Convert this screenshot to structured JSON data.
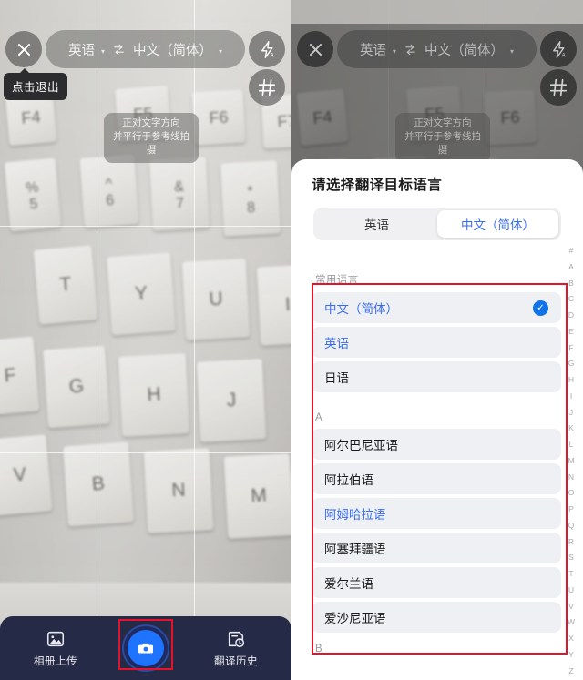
{
  "camera": {
    "close_icon": "close-icon",
    "flash_icon": "flash-auto-icon",
    "grid_icon": "grid-icon",
    "source_language": "英语",
    "swap_icon": "swap-languages-icon",
    "target_language": "中文（简体）",
    "caret": "▾",
    "exit_tooltip": "点击退出",
    "hint_line1": "正对文字方向",
    "hint_line2": "并平行于参考线拍摄",
    "keycaps": [
      "F4",
      "F5",
      "F6",
      "F7",
      "%",
      "5",
      "^",
      "6",
      "&",
      "7",
      "*",
      "8",
      "T",
      "Y",
      "U",
      "I",
      "F",
      "G",
      "H",
      "J",
      "V",
      "B",
      "N",
      "M"
    ]
  },
  "bottom_bar": {
    "album_label": "相册上传",
    "album_icon": "photo-icon",
    "shutter_icon": "camera-icon",
    "history_label": "翻译历史",
    "history_icon": "history-icon"
  },
  "sheet": {
    "title": "请选择翻译目标语言",
    "segments": [
      {
        "label": "英语",
        "active": false
      },
      {
        "label": "中文（简体）",
        "active": true
      }
    ],
    "common_section_label": "常用语言",
    "common_languages": [
      {
        "label": "中文（简体）",
        "selected": true,
        "highlighted": true
      },
      {
        "label": "英语",
        "selected": false,
        "highlighted": true
      },
      {
        "label": "日语",
        "selected": false,
        "highlighted": false
      }
    ],
    "a_section_label": "A",
    "a_languages": [
      {
        "label": "阿尔巴尼亚语",
        "highlighted": false
      },
      {
        "label": "阿拉伯语",
        "highlighted": false
      },
      {
        "label": "阿姆哈拉语",
        "highlighted": true
      },
      {
        "label": "阿塞拜疆语",
        "highlighted": false
      },
      {
        "label": "爱尔兰语",
        "highlighted": false
      },
      {
        "label": "爱沙尼亚语",
        "highlighted": false
      }
    ],
    "b_section_label": "B",
    "check_icon": "checkmark-icon",
    "alphabet_index": [
      "#",
      "A",
      "B",
      "C",
      "D",
      "E",
      "F",
      "G",
      "H",
      "I",
      "J",
      "K",
      "L",
      "M",
      "N",
      "O",
      "P",
      "Q",
      "R",
      "S",
      "T",
      "U",
      "V",
      "W",
      "X",
      "Y",
      "Z"
    ]
  },
  "annotations": {
    "accent_red": "#e8112a",
    "accent_blue": "#1273e8",
    "link_blue": "#3a6df0"
  }
}
